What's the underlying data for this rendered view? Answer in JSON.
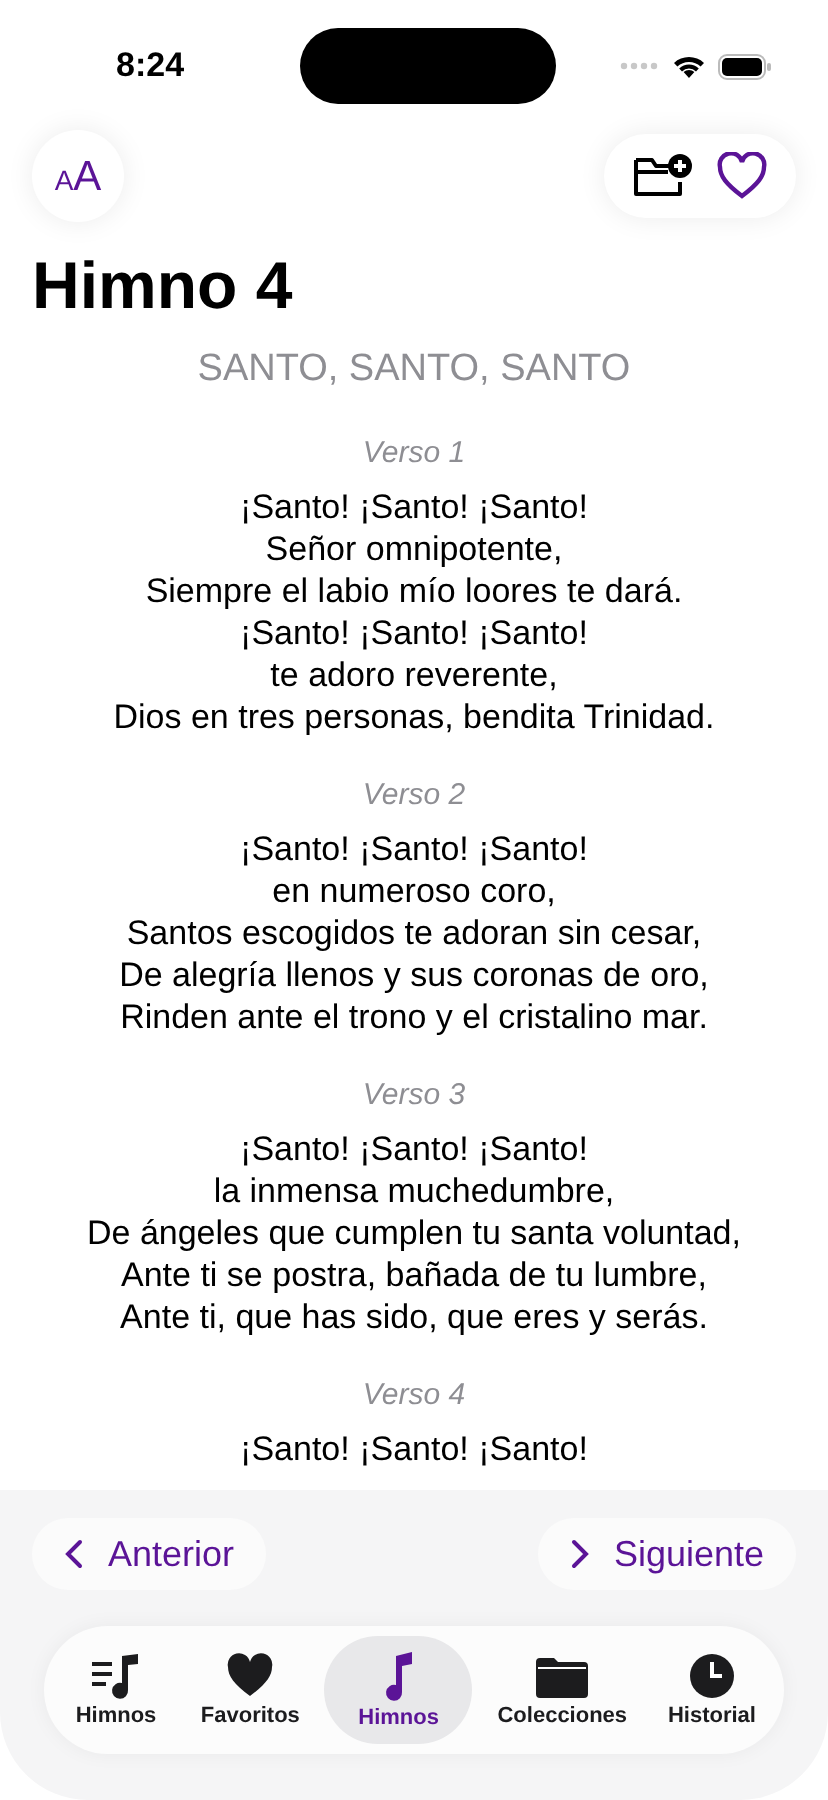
{
  "status_bar": {
    "time": "8:24"
  },
  "header": {
    "font_button": {
      "small": "A",
      "large": "A"
    }
  },
  "hymn": {
    "title": "Himno 4",
    "subtitle": "SANTO, SANTO, SANTO",
    "verses": [
      {
        "label": "Verso 1",
        "lines": [
          "¡Santo! ¡Santo! ¡Santo!",
          "Señor omnipotente,",
          "Siempre el labio mío loores te dará.",
          "¡Santo! ¡Santo! ¡Santo!",
          "te adoro reverente,",
          "Dios en tres personas, bendita Trinidad."
        ]
      },
      {
        "label": "Verso 2",
        "lines": [
          "¡Santo! ¡Santo! ¡Santo!",
          "en numeroso coro,",
          "Santos escogidos te adoran sin cesar,",
          "De alegría llenos y sus coronas de oro,",
          "Rinden ante el trono y el cristalino mar."
        ]
      },
      {
        "label": "Verso 3",
        "lines": [
          "¡Santo! ¡Santo! ¡Santo!",
          "la inmensa muchedumbre,",
          "De ángeles que cumplen tu santa voluntad,",
          "Ante ti se postra, bañada de tu lumbre,",
          "Ante ti, que has sido, que eres y serás."
        ]
      },
      {
        "label": "Verso 4",
        "lines": [
          "¡Santo! ¡Santo! ¡Santo!"
        ]
      }
    ]
  },
  "navigation": {
    "previous": "Anterior",
    "next": "Siguiente"
  },
  "tabs": [
    {
      "label": "Himnos",
      "kind": "list",
      "selected": false
    },
    {
      "label": "Favoritos",
      "kind": "heart",
      "selected": false
    },
    {
      "label": "Himnos",
      "kind": "note",
      "selected": true
    },
    {
      "label": "Colecciones",
      "kind": "folder",
      "selected": false
    },
    {
      "label": "Historial",
      "kind": "clock",
      "selected": false
    }
  ]
}
